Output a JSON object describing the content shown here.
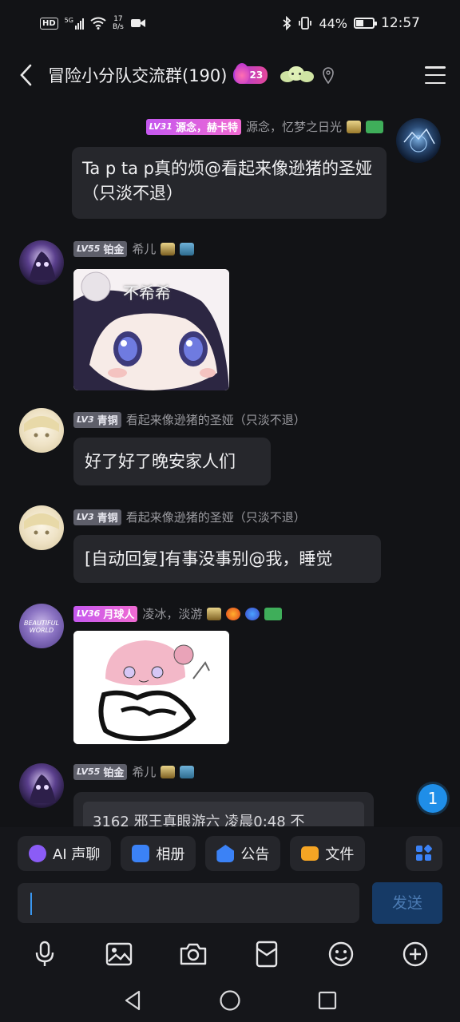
{
  "status_bar": {
    "hd": "HD",
    "network": "5G",
    "speed_value": "17",
    "speed_unit": "B/s",
    "battery": "44%",
    "battery_level": 0.44,
    "time": "12:57"
  },
  "header": {
    "title": "冒险小分队交流群(190)",
    "badge_count": "23"
  },
  "messages": [
    {
      "level": "LV31",
      "rank": "源念，赫卡特",
      "name": "源念，忆梦之日光",
      "text": "Ta p ta p真的烦@看起来像逊猪的圣娅（只淡不退）",
      "side": "right"
    },
    {
      "level": "LV55",
      "rank": "铂金",
      "name": "希儿",
      "sticker_text": "不希希",
      "side": "left"
    },
    {
      "level": "LV3",
      "rank": "青铜",
      "name": "看起来像逊猪的圣娅（只淡不退）",
      "text": "好了好了晚安家人们",
      "side": "left"
    },
    {
      "level": "LV3",
      "rank": "青铜",
      "name": "看起来像逊猪的圣娅（只淡不退）",
      "text": "[自动回复]有事没事别@我，睡觉",
      "side": "left"
    },
    {
      "level": "LV36",
      "rank": "月球人",
      "name": "凌冰，淡游",
      "avatar_text": "BEAUTIFUL WORLD",
      "side": "left"
    },
    {
      "level": "LV55",
      "rank": "铂金",
      "name": "希儿",
      "text": "3162  邪王真眼游六  凌晨0:48  不",
      "side": "left"
    }
  ],
  "unread_count": "1",
  "quick_actions": [
    {
      "label": "AI 声聊",
      "icon": "ai-voice-icon",
      "color": "#8b5cf6"
    },
    {
      "label": "相册",
      "icon": "album-icon",
      "color": "#3b82f6"
    },
    {
      "label": "公告",
      "icon": "announcement-icon",
      "color": "#3b82f6"
    },
    {
      "label": "文件",
      "icon": "folder-icon",
      "color": "#f5a524"
    }
  ],
  "input": {
    "value": "",
    "send_label": "发送"
  },
  "toolbar": [
    "microphone-icon",
    "image-icon",
    "camera-icon",
    "red-packet-icon",
    "emoji-icon",
    "plus-icon"
  ],
  "nav": [
    "back-triangle-icon",
    "home-circle-icon",
    "recents-square-icon"
  ]
}
